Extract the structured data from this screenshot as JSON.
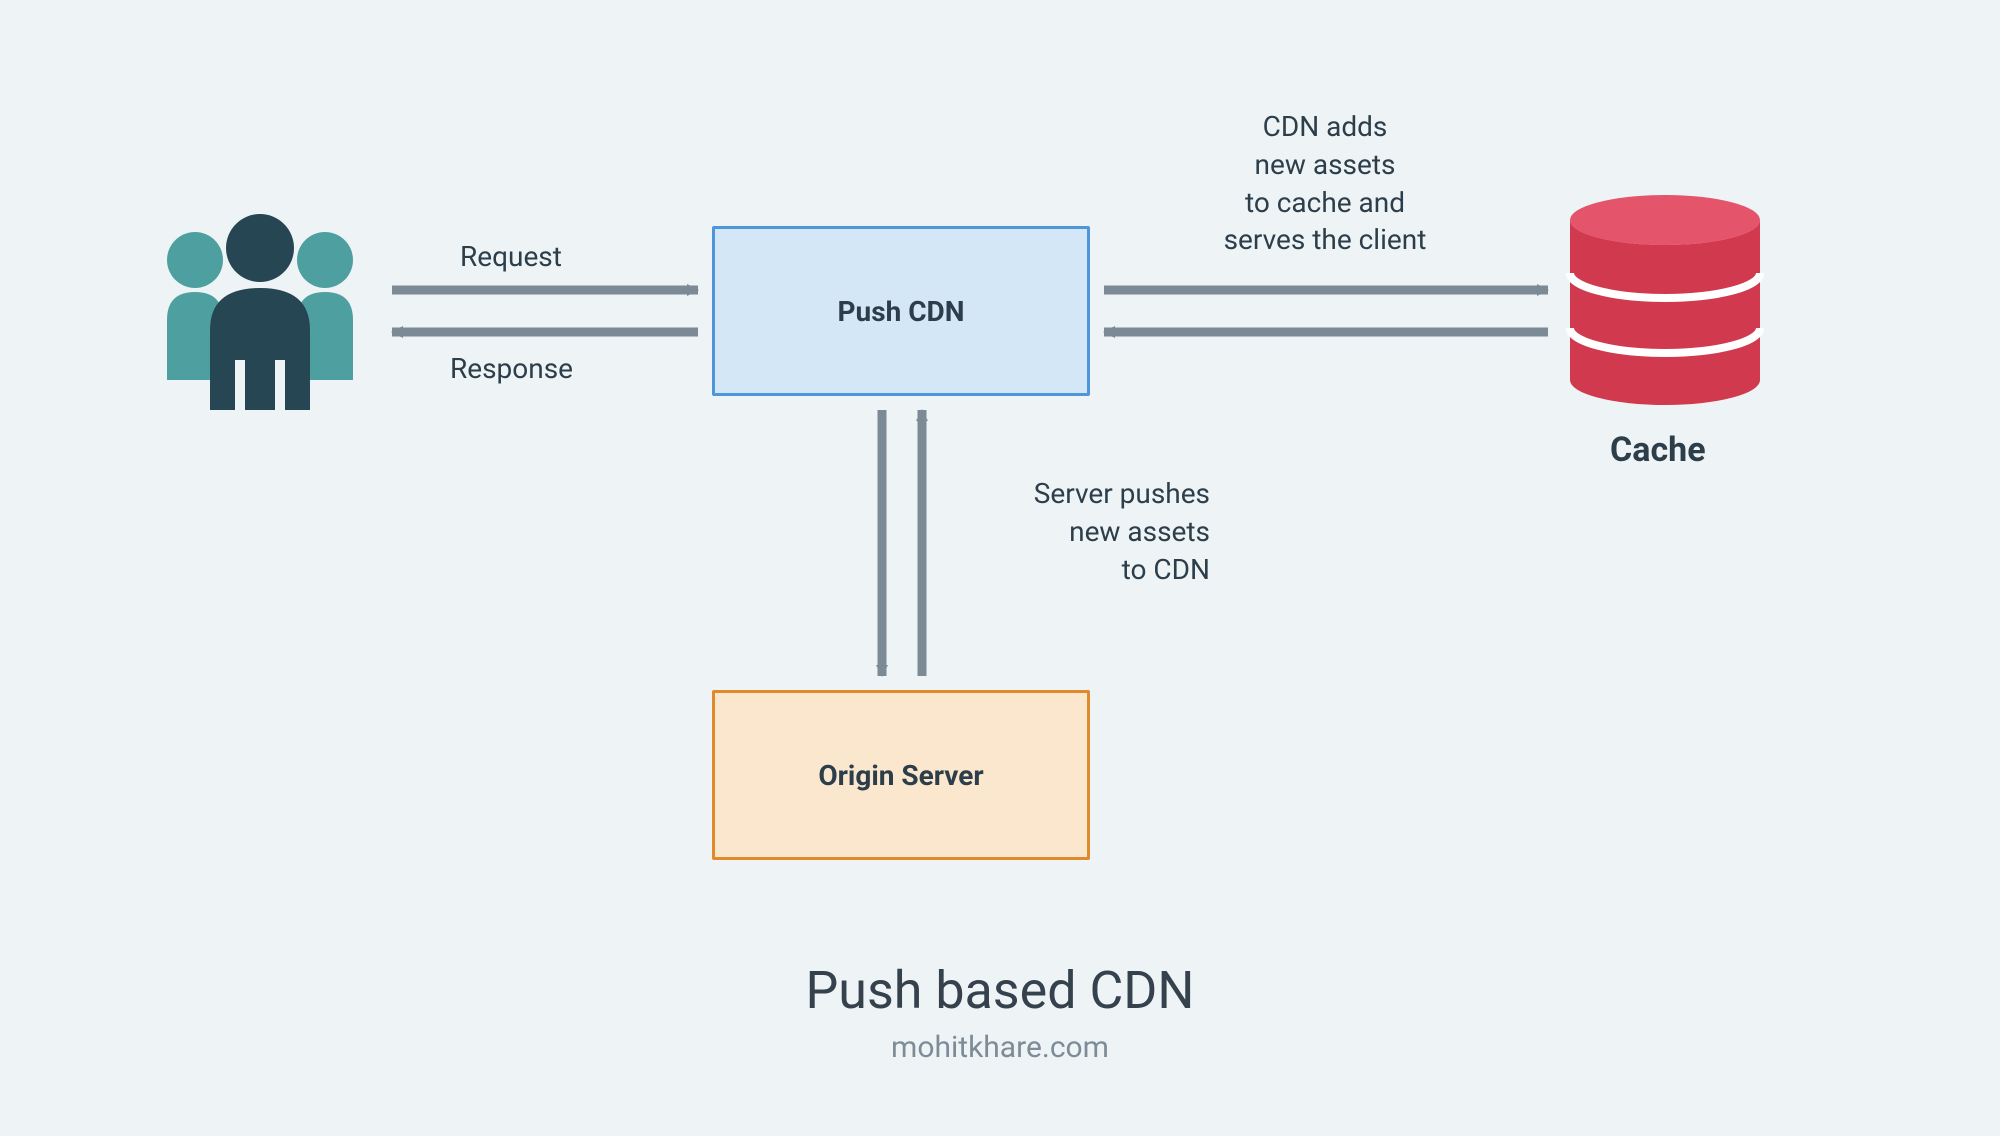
{
  "title": "Push based CDN",
  "subtitle": "mohitkhare.com",
  "nodes": {
    "push_cdn": "Push CDN",
    "origin_server": "Origin Server",
    "cache": "Cache"
  },
  "edges": {
    "request": "Request",
    "response": "Response",
    "server_pushes": "Server pushes\nnew assets\nto CDN",
    "cdn_adds": "CDN adds\nnew assets\nto cache and\nserves the client"
  },
  "colors": {
    "bg": "#eef3f6",
    "arrow": "#7c8a95",
    "push_cdn_fill": "#d4e7f7",
    "push_cdn_border": "#4e95d9",
    "origin_fill": "#fbe6ce",
    "origin_border": "#e08a2c",
    "cache_red": "#d13a4e",
    "cache_highlight": "#e4546a",
    "people_teal": "#4ea0a0",
    "people_dark": "#264653",
    "text": "#2c3e4a"
  }
}
